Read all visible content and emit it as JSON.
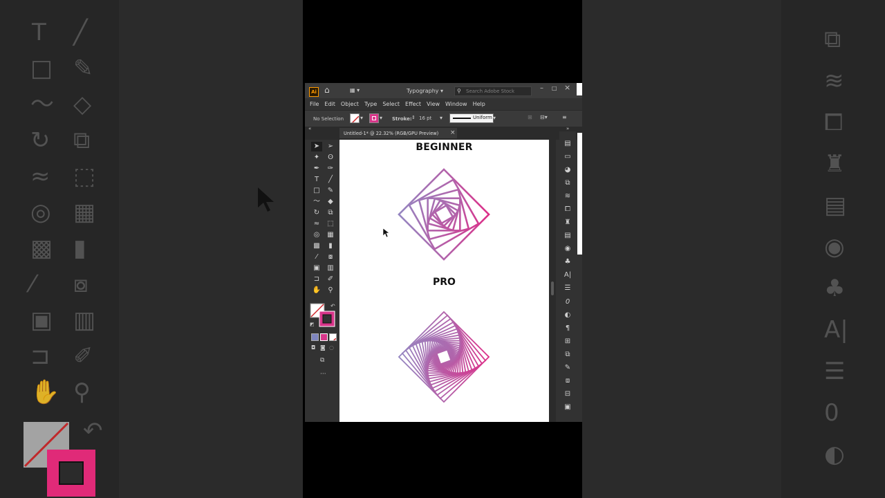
{
  "app": {
    "workspace": "Typography",
    "search_placeholder": "Search Adobe Stock"
  },
  "menu": [
    "File",
    "Edit",
    "Object",
    "Type",
    "Select",
    "Effect",
    "View",
    "Window",
    "Help"
  ],
  "control_bar": {
    "selection": "No Selection",
    "stroke_label": "Stroke:",
    "stroke_value": "16 pt",
    "profile": "Uniform"
  },
  "document": {
    "tab_title": "Untitled-1* @ 22.32% (RGB/GPU Preview)"
  },
  "artboard": {
    "label_beginner": "BEGINNER",
    "label_pro": "PRO"
  },
  "colors": {
    "pink": "#ec1c7c",
    "periwinkle": "#8c91c8",
    "ui_dark": "#323232"
  }
}
